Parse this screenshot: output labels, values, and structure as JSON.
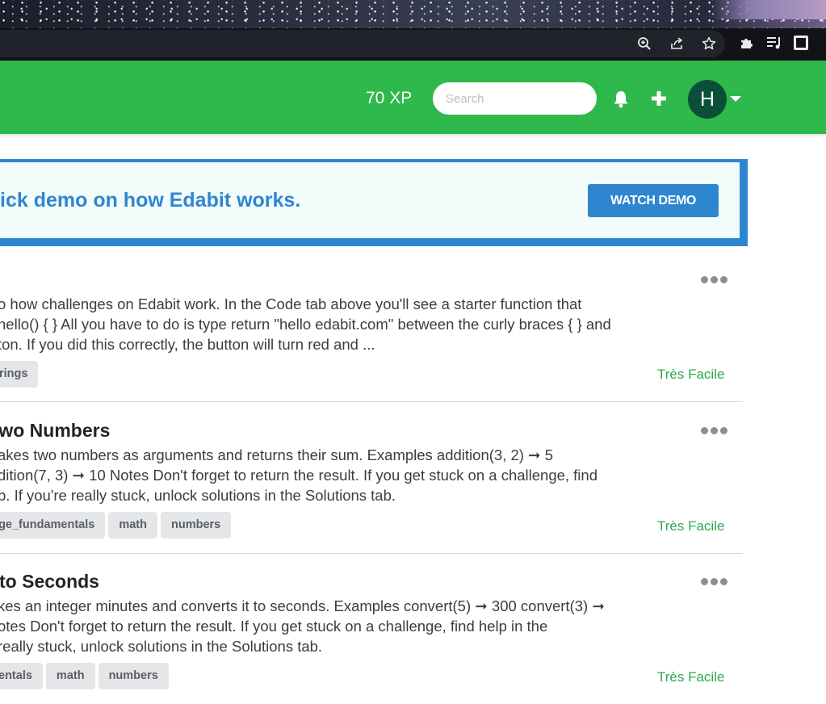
{
  "browser": {
    "icons": [
      "zoom-icon",
      "share-icon",
      "bookmark-star-icon",
      "extensions-puzzle-icon",
      "media-queue-icon",
      "side-panel-icon"
    ]
  },
  "nav": {
    "xp": "70 XP",
    "search_placeholder": "Search",
    "avatar_initial": "H",
    "brand_color": "#2fb84b"
  },
  "banner": {
    "text": "ick demo on how Edabit works.",
    "button_label": "WATCH DEMO",
    "accent": "#2f86d0"
  },
  "challenges": [
    {
      "title": "",
      "desc_lines": [
        "o how challenges on Edabit work. In the Code tab above you'll see a starter function that",
        "hello() { } All you have to do is type return \"hello edabit.com\" between the curly braces { } and",
        "ton. If you did this correctly, the button will turn red and ..."
      ],
      "tags": [
        "rings"
      ],
      "difficulty": "Très Facile"
    },
    {
      "title": "Two Numbers",
      "desc_lines": [
        "akes two numbers as arguments and returns their sum. Examples addition(3, 2) ➞ 5",
        "dition(7, 3) ➞ 10 Notes Don't forget to return the result. If you get stuck on a challenge, find",
        "b. If you're really stuck, unlock solutions in the Solutions tab."
      ],
      "tags": [
        "age_fundamentals",
        "math",
        "numbers"
      ],
      "difficulty": "Très Facile"
    },
    {
      "title": "to Seconds",
      "desc_lines": [
        "kes an integer minutes and converts it to seconds. Examples convert(5) ➞ 300 convert(3) ➞",
        "otes Don't forget to return the result. If you get stuck on a challenge, find help in the",
        "really stuck, unlock solutions in the Solutions tab."
      ],
      "tags": [
        "entals",
        "math",
        "numbers"
      ],
      "difficulty": "Très Facile"
    }
  ]
}
